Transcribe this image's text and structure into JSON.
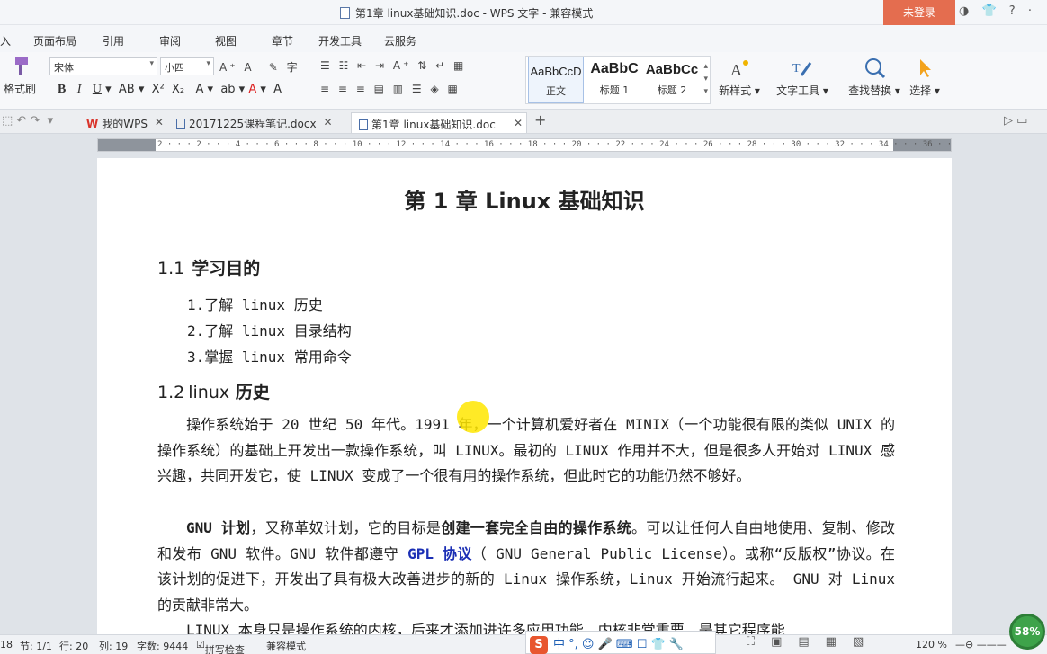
{
  "window": {
    "title": "第1章 linux基础知识.doc - WPS 文字 - 兼容模式",
    "login": "未登录"
  },
  "menu": [
    "页面布局",
    "引用",
    "审阅",
    "视图",
    "章节",
    "开发工具",
    "云服务"
  ],
  "ribbon": {
    "format_painter": "格式刷",
    "font_name": "宋体",
    "font_size": "小四",
    "styles": [
      {
        "preview": "AaBbCcD",
        "name": "正文"
      },
      {
        "preview": "AaBbC",
        "name": "标题 1"
      },
      {
        "preview": "AaBbCc",
        "name": "标题 2"
      }
    ],
    "new_style": "新样式",
    "text_tools": "文字工具",
    "find_replace": "查找替换",
    "select": "选择"
  },
  "tabs": [
    {
      "label": "我的WPS",
      "active": false
    },
    {
      "label": "20171225课程笔记.docx",
      "active": false
    },
    {
      "label": "第1章 linux基础知识.doc",
      "active": true
    }
  ],
  "ruler": {
    "numbers": "2 · · · 2 · · · 4 · · · 6 · · · 8 · · · 10 · · · 12 · · · 14 · · · 16 · · · 18 · · · 20 · · · 22 · · · 24 · · · 26 · · · 28 · · · 30 · · · 32 · · · 34 · · · 36 · · · 38 · · · 40 · · · 42 · · · 44"
  },
  "document": {
    "title": "第 1 章  Linux 基础知识",
    "section1": {
      "num": "1.1",
      "title": "学习目的"
    },
    "goals": [
      "1.了解 linux 历史",
      "2.了解 linux 目录结构",
      "3.掌握 linux 常用命令"
    ],
    "section2": {
      "num": "1.2",
      "title_prefix": "linux",
      "title": "历史"
    },
    "para1": "操作系统始于 20 世纪 50 年代。1991 年，一个计算机爱好者在 MINIX（一个功能很有限的类似 UNIX 的操作系统）的基础上开发出一款操作系统，叫 LINUX。最初的 LINUX 作用并不大，但是很多人开始对 LINUX 感兴趣，共同开发它，使 LINUX 变成了一个很有用的操作系统，但此时它的功能仍然不够好。",
    "para2": {
      "bold1": "GNU 计划",
      "t1": "，又称革奴计划，它的目标是",
      "bold2": "创建一套完全自由的操作系统",
      "t2": "。可以让任何人自由地使用、复制、修改和发布 GNU 软件。GNU 软件都遵守 ",
      "blue": "GPL 协议",
      "t3": "（ GNU General Public License）。或称“反版权”协议。在该计划的促进下，开发出了具有极大改善进步的新的 Linux 操作系统，Linux 开始流行起来。 GNU 对 Linux 的贡献非常大。"
    },
    "para3": "LINUX 本身只是操作系统的内核，后来才添加进许多应用功能，内核非常重要，是其它程序能"
  },
  "status": {
    "page_num": "18",
    "section": "节: 1/1",
    "row": "行: 20",
    "col": "列: 19",
    "word_count": "字数: 9444",
    "spell_check": "拼写检查",
    "compat": "兼容模式",
    "zoom": "120 %",
    "zoom_badge": "58%"
  },
  "colors": {
    "accent": "#e46d4f",
    "link_blue": "#1b2fb5",
    "zoom_green": "#3ea34a"
  }
}
